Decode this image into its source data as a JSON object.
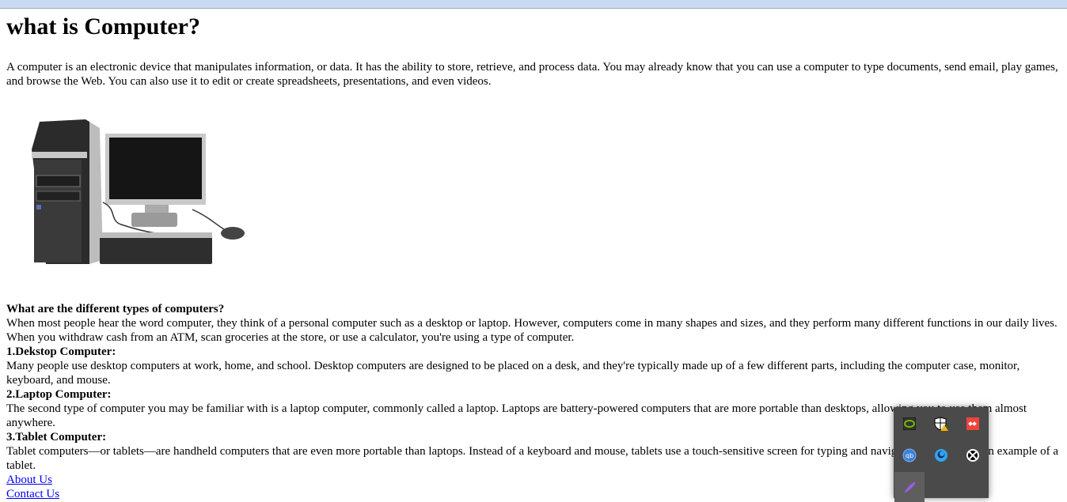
{
  "page": {
    "title": "what is Computer?",
    "intro": "A computer is an electronic device that manipulates information, or data. It has the ability to store, retrieve, and process data. You may already know that you can use a computer to type documents, send email, play games, and browse the Web. You can also use it to edit or create spreadsheets, presentations, and even videos.",
    "types_heading": "What are the different types of computers?",
    "types_intro": "When most people hear the word computer, they think of a personal computer such as a desktop or laptop. However, computers come in many shapes and sizes, and they perform many different functions in our daily lives. When you withdraw cash from an ATM, scan groceries at the store, or use a calculator, you're using a type of computer.",
    "sections": [
      {
        "heading": "1.Dekstop Computer:",
        "text": "Many people use desktop computers at work, home, and school. Desktop computers are designed to be placed on a desk, and they're typically made up of a few different parts, including the computer case, monitor, keyboard, and mouse."
      },
      {
        "heading": "2.Laptop Computer:",
        "text": "The second type of computer you may be familiar with is a laptop computer, commonly called a laptop. Laptops are battery-powered computers that are more portable than desktops, allowing you to use them almost anywhere."
      },
      {
        "heading": "3.Tablet Computer:",
        "text": "Tablet computers—or tablets—are handheld computers that are even more portable than laptops. Instead of a keyboard and mouse, tablets use a touch-sensitive screen for typing and navigation. The iPad is an example of a tablet."
      }
    ],
    "links": [
      "About Us",
      "Contact Us"
    ]
  },
  "tray": {
    "icons": [
      "nvidia-icon",
      "windows-security-warning-icon",
      "anydesk-icon",
      "qbittorrent-icon",
      "app-icon",
      "xbox-icon",
      "feather-icon"
    ],
    "colors": {
      "nvidia": "#76b900",
      "anydesk": "#ef443b",
      "qb": "#3d7fd6"
    }
  }
}
